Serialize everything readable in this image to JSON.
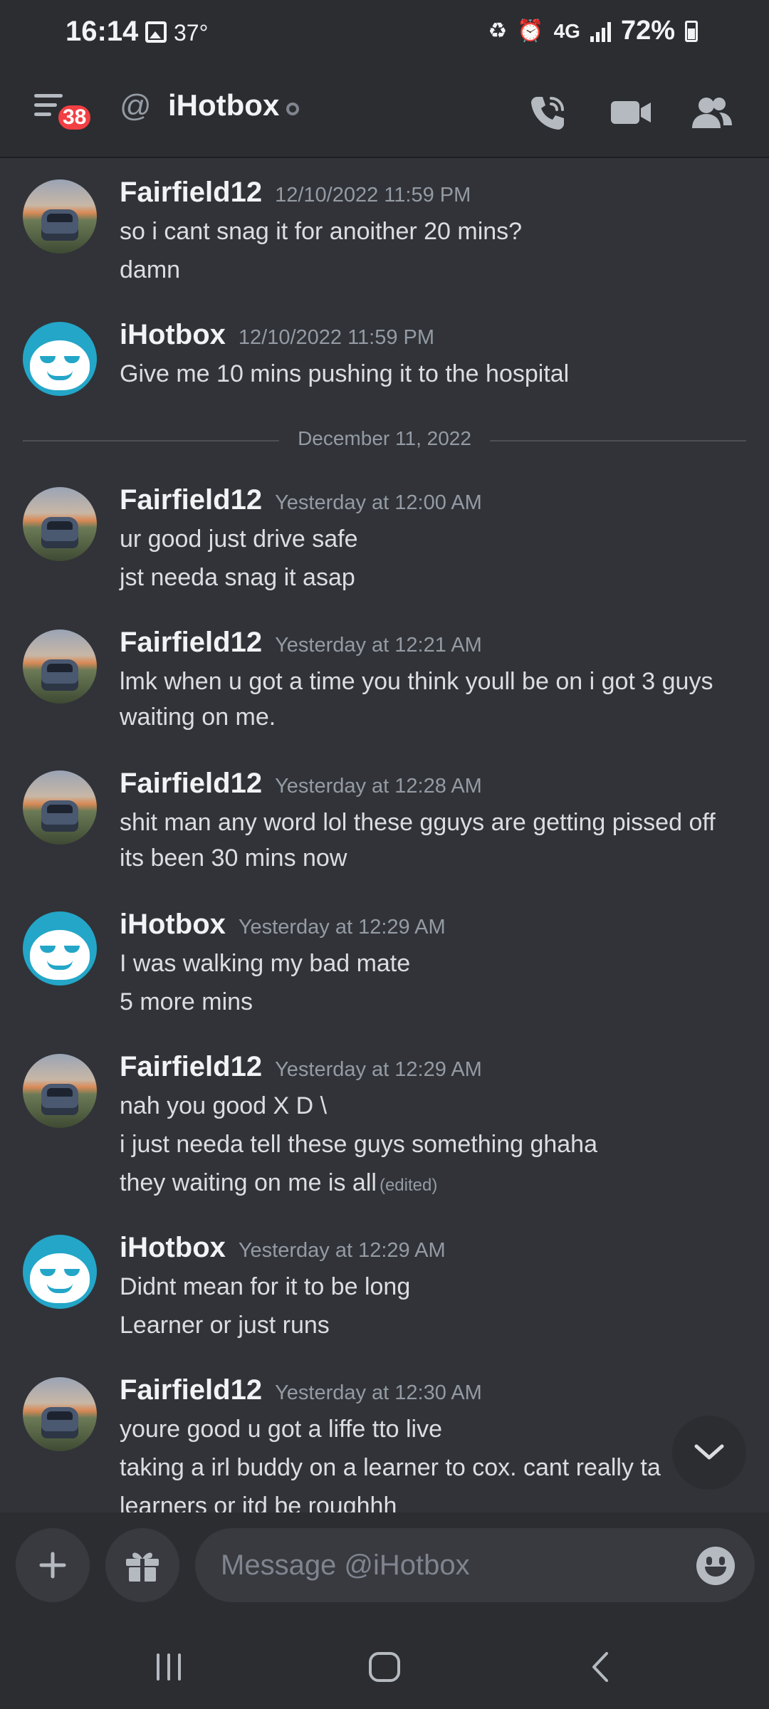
{
  "status_bar": {
    "time": "16:14",
    "temperature": "37°",
    "network": "4G",
    "battery": "72%"
  },
  "header": {
    "badge_count": "38",
    "at_symbol": "@",
    "title": "iHotbox",
    "status": "offline"
  },
  "messages": [
    {
      "author": "Fairfield12",
      "avatar": "car-avatar",
      "time": "12/10/2022 11:59 PM",
      "lines": [
        "so i cant snag it for anoither 20 mins?",
        "damn"
      ]
    },
    {
      "author": "iHotbox",
      "avatar": "sloth-avatar",
      "time": "12/10/2022 11:59 PM",
      "lines": [
        "Give me 10 mins pushing it to the hospital"
      ]
    },
    {
      "author": "Fairfield12",
      "avatar": "car-avatar",
      "time": "Yesterday at 12:00 AM",
      "lines": [
        "ur good just drive safe",
        "jst needa snag it asap"
      ]
    },
    {
      "author": "Fairfield12",
      "avatar": "car-avatar",
      "time": "Yesterday at 12:21 AM",
      "lines": [
        "lmk when u got a time you think youll be on i got 3 guys",
        "waiting on me."
      ]
    },
    {
      "author": "Fairfield12",
      "avatar": "car-avatar",
      "time": "Yesterday at 12:28 AM",
      "lines": [
        "shit man any word lol these gguys are getting pissed off",
        "its been 30 mins now"
      ]
    },
    {
      "author": "iHotbox",
      "avatar": "sloth-avatar",
      "time": "Yesterday at 12:29 AM",
      "lines": [
        "I was walking my bad mate",
        "5 more mins"
      ]
    },
    {
      "author": "Fairfield12",
      "avatar": "car-avatar",
      "time": "Yesterday at 12:29 AM",
      "lines": [
        "nah you good X D \\",
        "i just needa tell these guys something ghaha",
        "they waiting on me is all"
      ],
      "edited": "(edited)"
    },
    {
      "author": "iHotbox",
      "avatar": "sloth-avatar",
      "time": "Yesterday at 12:29 AM",
      "lines": [
        "Didnt mean for it to be long",
        "Learner or just runs"
      ]
    },
    {
      "author": "Fairfield12",
      "avatar": "car-avatar",
      "time": "Yesterday at 12:30 AM",
      "lines": [
        "youre good u got a liffe tto live",
        "taking a irl buddy on a learner to cox. cant really ta",
        "learners or itd be roughhh"
      ]
    }
  ],
  "date_divider": "December 11, 2022",
  "composer": {
    "placeholder": "Message @iHotbox"
  },
  "icons": {
    "menu": "menu-icon",
    "call": "phone-call-icon",
    "video": "video-camera-icon",
    "members": "members-icon",
    "add": "plus-icon",
    "gift": "gift-icon",
    "emoji": "emoji-icon",
    "scroll": "chevron-down-icon"
  },
  "colors": {
    "background": "#313338",
    "header": "#2b2d31",
    "badge": "#f23f43",
    "text": "#dbdee1",
    "muted": "#949ba4"
  }
}
